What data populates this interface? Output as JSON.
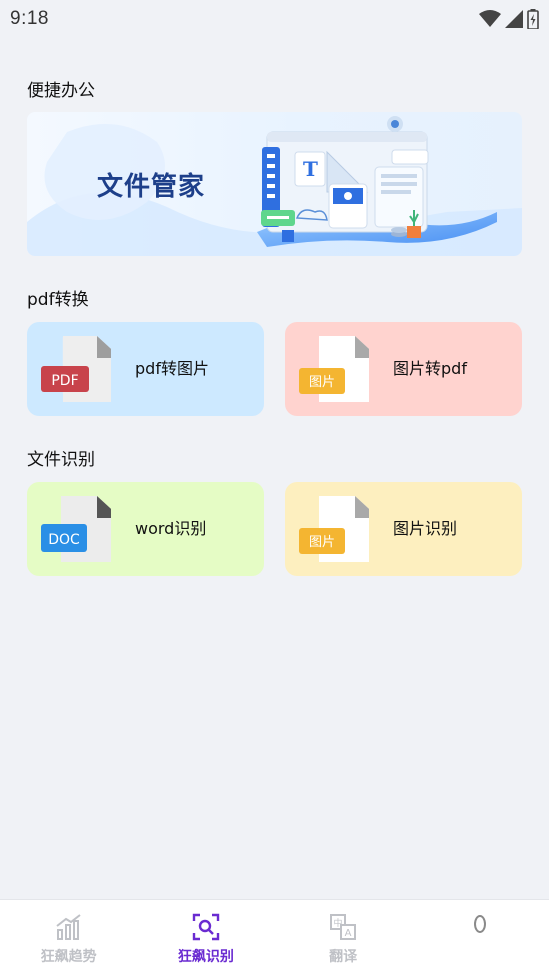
{
  "status_bar": {
    "time": "9:18"
  },
  "sections": {
    "office": "便捷办公",
    "pdf": "pdf转换",
    "recognize": "文件识别"
  },
  "banner": {
    "text": "文件管家"
  },
  "cards": {
    "pdf_to_image": {
      "label": "pdf转图片",
      "badge": "PDF",
      "color": "#cde9ff",
      "badge_color": "#c8434b"
    },
    "image_to_pdf": {
      "label": "图片转pdf",
      "badge": "图片",
      "color": "#ffd3cf",
      "badge_color": "#f4b531"
    },
    "word_recognize": {
      "label": "word识别",
      "badge": "DOC",
      "color": "#e5fcc5",
      "badge_color": "#2a8fe6"
    },
    "image_recognize": {
      "label": "图片识别",
      "badge": "图片",
      "color": "#fdefbf",
      "badge_color": "#f4b531"
    }
  },
  "tabbar": {
    "tabs": [
      {
        "label": "狂飙趋势",
        "icon": "chart-icon",
        "active": false
      },
      {
        "label": "狂飙识别",
        "icon": "scan-search-icon",
        "active": true
      },
      {
        "label": "翻译",
        "icon": "translate-icon",
        "active": false
      },
      {
        "label": "",
        "icon": "profile-icon",
        "active": false
      }
    ],
    "active_color": "#6a2bd1",
    "inactive_color": "#bfc1c6"
  }
}
